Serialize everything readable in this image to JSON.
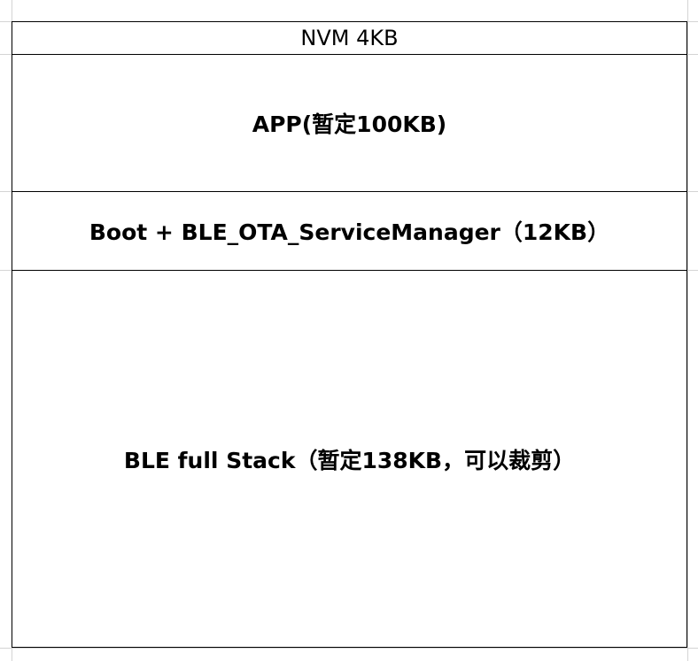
{
  "memory_map": {
    "regions": [
      {
        "label": "NVM 4KB"
      },
      {
        "label": "APP(暂定100KB)"
      },
      {
        "label": "Boot + BLE_OTA_ServiceManager（12KB）"
      },
      {
        "label": "BLE full Stack（暂定138KB，可以裁剪）"
      }
    ]
  },
  "colors": {
    "border": "#000000",
    "grid": "#d4d4d4",
    "background": "#ffffff"
  }
}
